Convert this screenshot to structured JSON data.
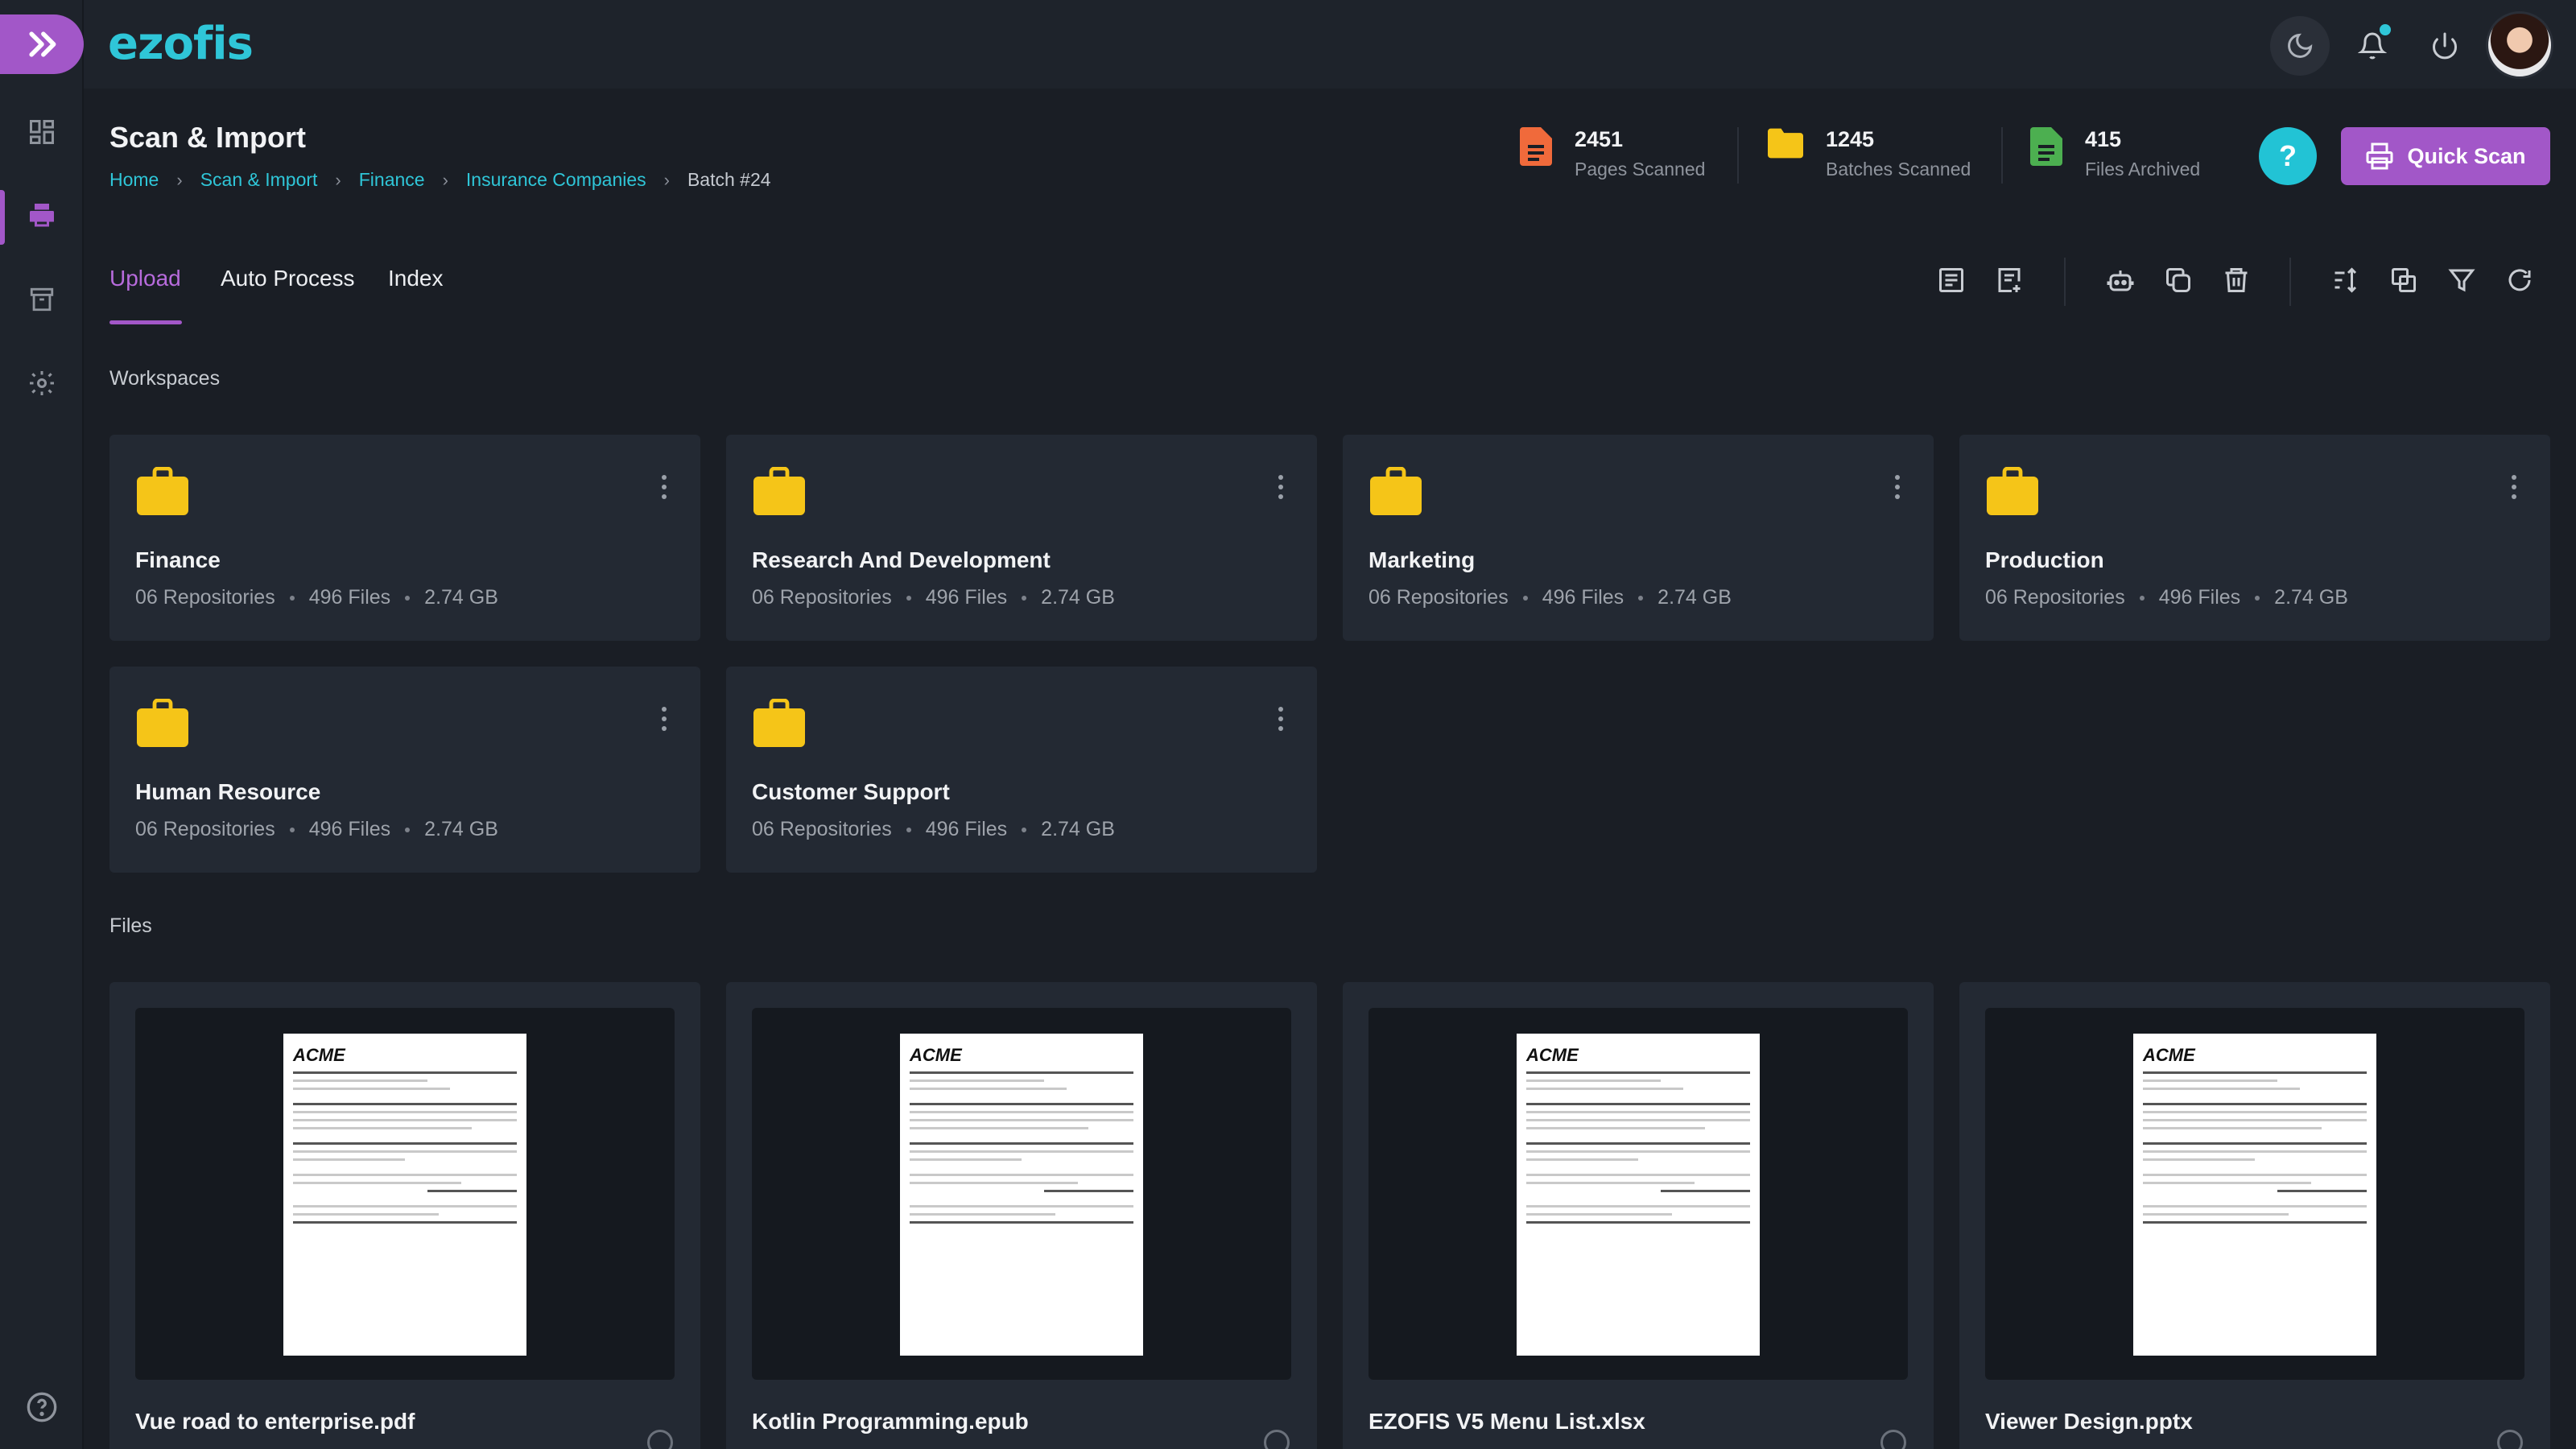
{
  "app": {
    "logo": "ezofis"
  },
  "page": {
    "title": "Scan & Import",
    "breadcrumb": [
      "Home",
      "Scan & Import",
      "Finance",
      "Insurance Companies",
      "Batch #24"
    ]
  },
  "stats": [
    {
      "value": "2451",
      "label": "Pages Scanned",
      "icon": "file-icon",
      "color": "#f06a3b"
    },
    {
      "value": "1245",
      "label": "Batches Scanned",
      "icon": "folder-icon",
      "color": "#f5c518"
    },
    {
      "value": "415",
      "label": "Files Archived",
      "icon": "archive-file-icon",
      "color": "#4caf50"
    }
  ],
  "actions": {
    "help": "?",
    "quick_scan": "Quick Scan"
  },
  "tabs": [
    {
      "label": "Upload",
      "active": true
    },
    {
      "label": "Auto Process",
      "active": false
    },
    {
      "label": "Index",
      "active": false
    }
  ],
  "sections": {
    "workspaces": "Workspaces",
    "files": "Files"
  },
  "workspaces": [
    {
      "name": "Finance",
      "repositories": "06 Repositories",
      "files": "496 Files",
      "size": "2.74 GB"
    },
    {
      "name": "Research And Development",
      "repositories": "06 Repositories",
      "files": "496 Files",
      "size": "2.74 GB"
    },
    {
      "name": "Marketing",
      "repositories": "06 Repositories",
      "files": "496 Files",
      "size": "2.74 GB"
    },
    {
      "name": "Production",
      "repositories": "06 Repositories",
      "files": "496 Files",
      "size": "2.74 GB"
    },
    {
      "name": "Human Resource",
      "repositories": "06 Repositories",
      "files": "496 Files",
      "size": "2.74 GB"
    },
    {
      "name": "Customer Support",
      "repositories": "06 Repositories",
      "files": "496 Files",
      "size": "2.74 GB"
    }
  ],
  "files": [
    {
      "name": "Vue road to enterprise.pdf",
      "preview_logo": "ACME"
    },
    {
      "name": "Kotlin Programming.epub",
      "preview_logo": "ACME"
    },
    {
      "name": "EZOFIS V5 Menu List.xlsx",
      "preview_logo": "ACME"
    },
    {
      "name": "Viewer Design.pptx",
      "preview_logo": "ACME"
    }
  ],
  "colors": {
    "accent": "#a257c8",
    "brand": "#2fc6d8",
    "folder": "#f5c518"
  }
}
